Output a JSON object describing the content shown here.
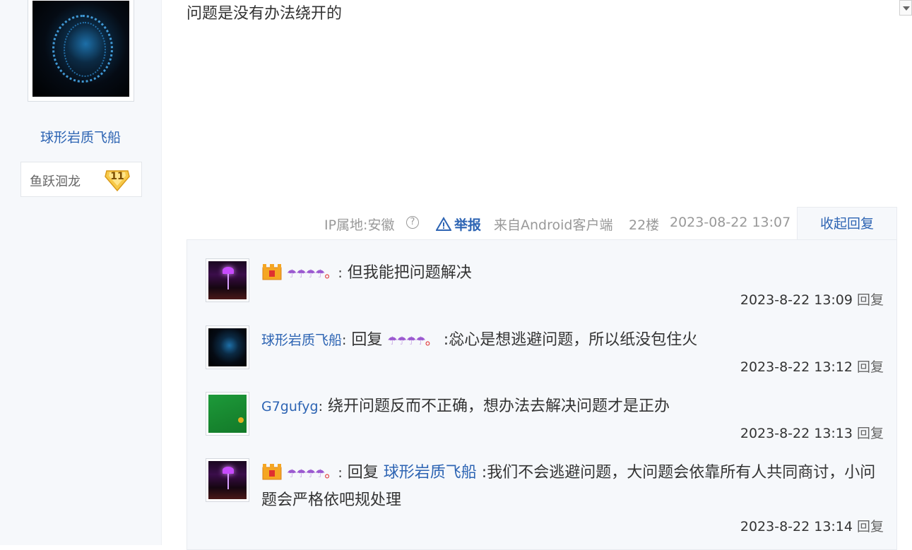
{
  "author": {
    "username": "球形岩质飞船",
    "level_name": "鱼跃洄龙",
    "level_number": "11"
  },
  "post": {
    "text": "问题是没有办法绕开的",
    "ip_location": "IP属地:安徽",
    "help_icon": "?",
    "report_label": "举报",
    "source": "来自Android客户端",
    "floor": "22楼",
    "timestamp": "2023-08-22 13:07",
    "collapse_label": "收起回复"
  },
  "replies": [
    {
      "avatar": "umbrella",
      "vip": true,
      "author_umbrellas": "☂☂☂☂",
      "author_dot": "。",
      "separator": ":",
      "reply_to_prefix": "",
      "reply_to": "",
      "content": " 但我能把问题解决",
      "time": "2023-8-22 13:09",
      "reply_btn": "回复"
    },
    {
      "avatar": "sphere",
      "author": "球形岩质飞船",
      "separator": ":",
      "reply_prefix": " 回复 ",
      "reply_to_umbrellas": "☂☂☂☂",
      "reply_to_dot": "。",
      "content": " :惢心是想逃避问题，所以纸没包住火",
      "time": "2023-8-22 13:12",
      "reply_btn": "回复"
    },
    {
      "avatar": "green",
      "author": "G7gufyg",
      "separator": ":",
      "content": " 绕开问题反而不正确，想办法去解决问题才是正办",
      "time": "2023-8-22 13:13",
      "reply_btn": "回复"
    },
    {
      "avatar": "umbrella",
      "vip": true,
      "author_umbrellas": "☂☂☂☂",
      "author_dot": "。",
      "separator": ":",
      "reply_prefix": " 回复 ",
      "reply_to": "球形岩质飞船",
      "content": " :我们不会逃避问题，大问题会依靠所有人共同商讨，小问题会严格依吧规处理",
      "time": "2023-8-22 13:14",
      "reply_btn": "回复"
    }
  ],
  "colors": {
    "link": "#2d64b3",
    "meta": "#999999",
    "panel_bg": "#f6f8fb"
  }
}
